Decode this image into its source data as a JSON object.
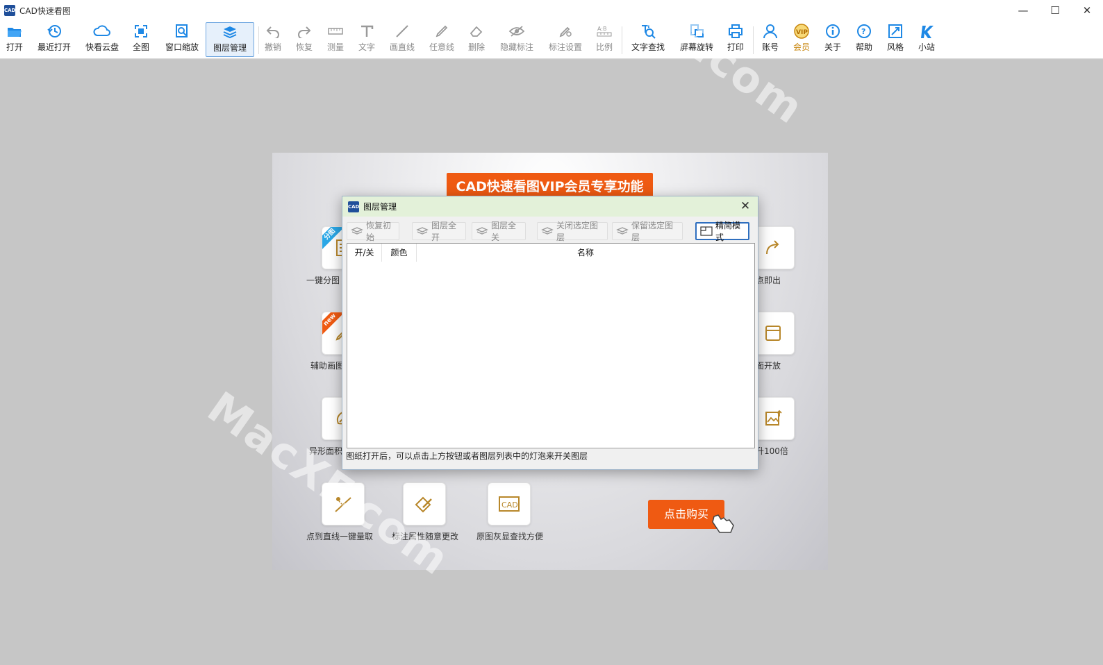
{
  "window": {
    "title": "CAD快速看图",
    "app_icon": "CAD",
    "controls": [
      "minimize-icon",
      "maximize-icon",
      "close-icon"
    ]
  },
  "toolbar": {
    "items": [
      {
        "id": "open",
        "label": "打开",
        "icon": "folder-open-icon",
        "state": "enabled"
      },
      {
        "id": "recent",
        "label": "最近打开",
        "icon": "history-icon",
        "state": "enabled"
      },
      {
        "id": "cloud",
        "label": "快看云盘",
        "icon": "cloud-icon",
        "state": "enabled"
      },
      {
        "id": "full",
        "label": "全图",
        "icon": "fit-all-icon",
        "state": "enabled"
      },
      {
        "id": "zoom",
        "label": "窗口缩放",
        "icon": "zoom-window-icon",
        "state": "enabled"
      },
      {
        "id": "layers",
        "label": "图层管理",
        "icon": "layers-icon",
        "state": "active"
      },
      {
        "id": "undo",
        "label": "撤销",
        "icon": "undo-icon",
        "state": "disabled"
      },
      {
        "id": "redo",
        "label": "恢复",
        "icon": "redo-icon",
        "state": "disabled"
      },
      {
        "id": "measure",
        "label": "测量",
        "icon": "ruler-icon",
        "state": "disabled"
      },
      {
        "id": "text",
        "label": "文字",
        "icon": "text-icon",
        "state": "disabled"
      },
      {
        "id": "line",
        "label": "画直线",
        "icon": "line-icon",
        "state": "disabled"
      },
      {
        "id": "freeline",
        "label": "任意线",
        "icon": "pen-icon",
        "state": "disabled"
      },
      {
        "id": "erase",
        "label": "删除",
        "icon": "eraser-icon",
        "state": "disabled"
      },
      {
        "id": "hide",
        "label": "隐藏标注",
        "icon": "eye-off-icon",
        "state": "disabled"
      },
      {
        "id": "annot",
        "label": "标注设置",
        "icon": "annotation-settings-icon",
        "state": "disabled"
      },
      {
        "id": "scale",
        "label": "比例",
        "icon": "scale-icon",
        "state": "disabled"
      },
      {
        "id": "find",
        "label": "文字查找",
        "icon": "text-search-icon",
        "state": "enabled"
      },
      {
        "id": "rotate",
        "label": "屏幕旋转",
        "icon": "rotate-screen-icon",
        "state": "enabled"
      },
      {
        "id": "print",
        "label": "打印",
        "icon": "printer-icon",
        "state": "enabled"
      },
      {
        "id": "account",
        "label": "账号",
        "icon": "user-icon",
        "state": "enabled"
      },
      {
        "id": "vip",
        "label": "会员",
        "icon": "vip-icon",
        "state": "vip"
      },
      {
        "id": "about",
        "label": "关于",
        "icon": "info-icon",
        "state": "enabled"
      },
      {
        "id": "help",
        "label": "帮助",
        "icon": "help-icon",
        "state": "enabled"
      },
      {
        "id": "style",
        "label": "风格",
        "icon": "style-icon",
        "state": "enabled"
      },
      {
        "id": "site",
        "label": "小站",
        "icon": "site-k-icon",
        "state": "enabled"
      }
    ]
  },
  "promo": {
    "title": "CAD快速看图VIP会员专享功能",
    "features": [
      {
        "caption": "一键分图",
        "badge": "分图"
      },
      {
        "caption": "一点即出",
        "badge": ""
      },
      {
        "caption": "辅助画图",
        "badge": "new"
      },
      {
        "caption": "全面开放",
        "badge": ""
      },
      {
        "caption": "异形面积",
        "badge": ""
      },
      {
        "caption": "提升100倍",
        "badge": ""
      },
      {
        "caption": "点到直线一键量取",
        "badge": ""
      },
      {
        "caption": "标注属性随意更改",
        "badge": ""
      },
      {
        "caption": "原图灰显查找方便",
        "badge": ""
      }
    ],
    "buy_label": "点击购买"
  },
  "dialog": {
    "title": "图层管理",
    "buttons": [
      {
        "label": "恢复初始",
        "enabled": false
      },
      {
        "label": "图层全开",
        "enabled": false
      },
      {
        "label": "图层全关",
        "enabled": false
      },
      {
        "label": "关闭选定图层",
        "enabled": false
      },
      {
        "label": "保留选定图层",
        "enabled": false
      },
      {
        "label": "精简模式",
        "enabled": true
      }
    ],
    "columns": [
      "开/关",
      "颜色",
      "名称"
    ],
    "rows": [],
    "status": "图纸打开后，可以点击上方按钮或者图层列表中的灯泡来开关图层"
  },
  "watermark": "MacXF.com",
  "colors": {
    "accent_blue": "#1e88e5",
    "promo_orange": "#ef5a12",
    "vip_gold": "#c8860d",
    "icon_gold": "#b8872a",
    "dialog_title_bg": "#e3f1d9"
  }
}
